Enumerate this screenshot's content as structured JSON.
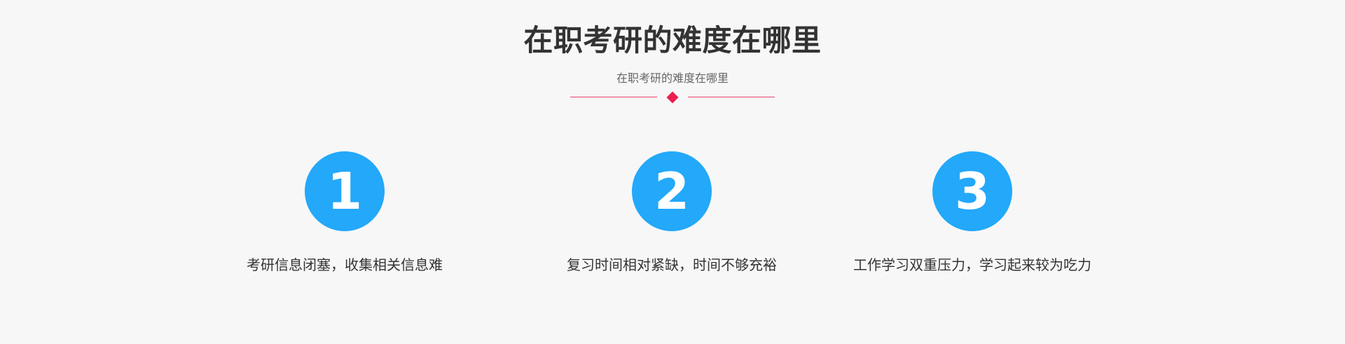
{
  "section": {
    "title": "在职考研的难度在哪里",
    "subtitle": "在职考研的难度在哪里",
    "accent_color": "#ec1f4e",
    "circle_color": "#23a8fa"
  },
  "items": [
    {
      "number": "1",
      "text": "考研信息闭塞，收集相关信息难"
    },
    {
      "number": "2",
      "text": "复习时间相对紧缺，时间不够充裕"
    },
    {
      "number": "3",
      "text": "工作学习双重压力，学习起来较为吃力"
    }
  ]
}
